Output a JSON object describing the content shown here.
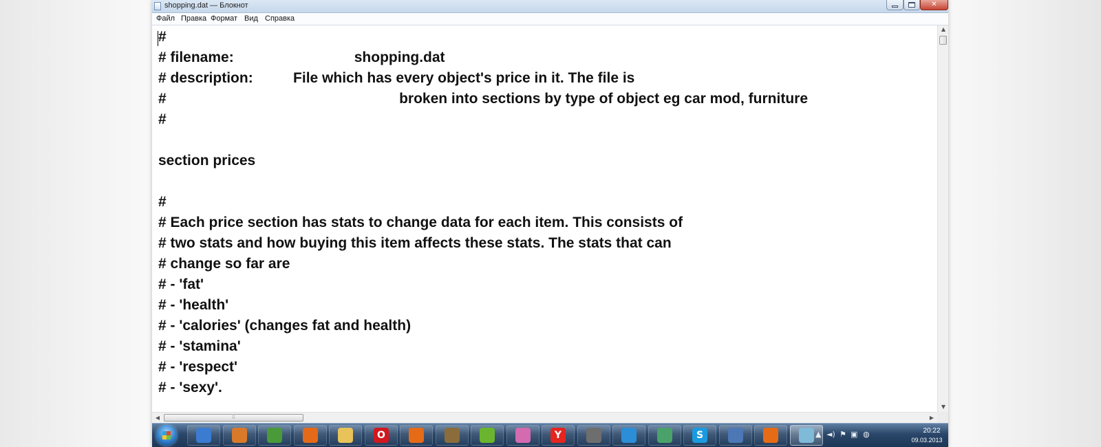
{
  "window": {
    "title": "shopping.dat — Блокнот"
  },
  "menu": [
    "Файл",
    "Правка",
    "Формат",
    "Вид",
    "Справка"
  ],
  "editor": {
    "lines": [
      "#",
      "# filename:                              shopping.dat",
      "# description:          File which has every object's price in it. The file is",
      "#                                                          broken into sections by type of object eg car mod, furniture",
      "#",
      "",
      "section prices",
      "",
      "#",
      "# Each price section has stats to change data for each item. This consists of",
      "# two stats and how buying this item affects these stats. The stats that can",
      "# change so far are",
      "# - 'fat'",
      "# - 'health'",
      "# - 'calories' (changes fat and health)",
      "# - 'stamina'",
      "# - 'respect'",
      "# - 'sexy'."
    ]
  },
  "taskbar": {
    "apps": [
      {
        "icon": "ie-tools-icon",
        "color": "#3b7bd0"
      },
      {
        "icon": "paint-icon",
        "color": "#d97a2b"
      },
      {
        "icon": "windows-flag-icon",
        "color": "#4a9a3a"
      },
      {
        "icon": "media-player-icon",
        "color": "#e46a1a"
      },
      {
        "icon": "folder-icon",
        "color": "#e7c35a"
      },
      {
        "icon": "opera-icon",
        "color": "#d0181e",
        "glyph": "O"
      },
      {
        "icon": "firefox-icon",
        "color": "#e66b17"
      },
      {
        "icon": "archive-icon",
        "color": "#8a6d3b"
      },
      {
        "icon": "game-icon",
        "color": "#6ab52d"
      },
      {
        "icon": "anime-app-icon",
        "color": "#d46ab0"
      },
      {
        "icon": "yandex-icon",
        "color": "#e52620",
        "glyph": "Y"
      },
      {
        "icon": "floppy-icon",
        "color": "#6e6e6e"
      },
      {
        "icon": "stack-icon",
        "color": "#2c8ed6"
      },
      {
        "icon": "people-icon",
        "color": "#4aa26a"
      },
      {
        "icon": "skype-icon",
        "color": "#1a9be0",
        "glyph": "S"
      },
      {
        "icon": "text-doc-icon",
        "color": "#4d78b5"
      },
      {
        "icon": "firefox-icon",
        "color": "#e66b17"
      },
      {
        "icon": "notepad-icon",
        "color": "#7fbad8",
        "active": true
      }
    ],
    "clock_time": "20:22",
    "clock_date": "09.03.2013"
  }
}
